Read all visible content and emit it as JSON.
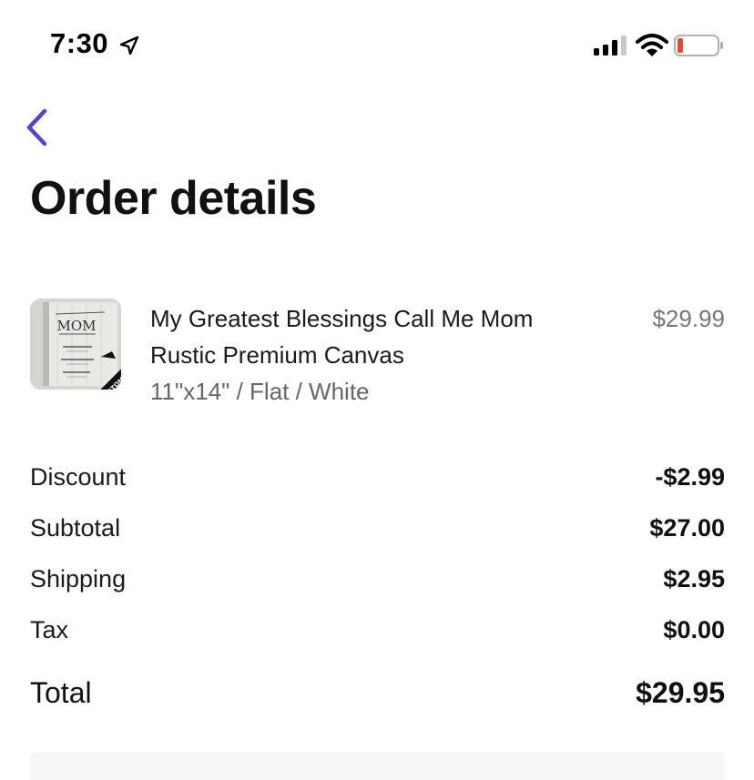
{
  "status_bar": {
    "time": "7:30",
    "icons": [
      "location-arrow-icon",
      "cellular-signal-icon",
      "wifi-icon",
      "battery-low-icon"
    ],
    "battery_color": "#e5473a"
  },
  "nav": {
    "back_icon": "chevron-left-icon",
    "accent_color": "#5a3fd6"
  },
  "page": {
    "title": "Order details"
  },
  "product": {
    "name_line1": "My Greatest Blessings Call Me Mom",
    "name_line2": "Rustic Premium Canvas",
    "variant": "11\"x14\" / Flat / White",
    "price": "$29.99",
    "thumb": {
      "heading": "MOM",
      "ribbon": "CUSTOMIZE"
    }
  },
  "summary": {
    "rows": [
      {
        "label": "Discount",
        "value": "-$2.99"
      },
      {
        "label": "Subtotal",
        "value": "$27.00"
      },
      {
        "label": "Shipping",
        "value": "$2.95"
      },
      {
        "label": "Tax",
        "value": "$0.00"
      }
    ],
    "total_label": "Total",
    "total_value": "$29.95"
  }
}
